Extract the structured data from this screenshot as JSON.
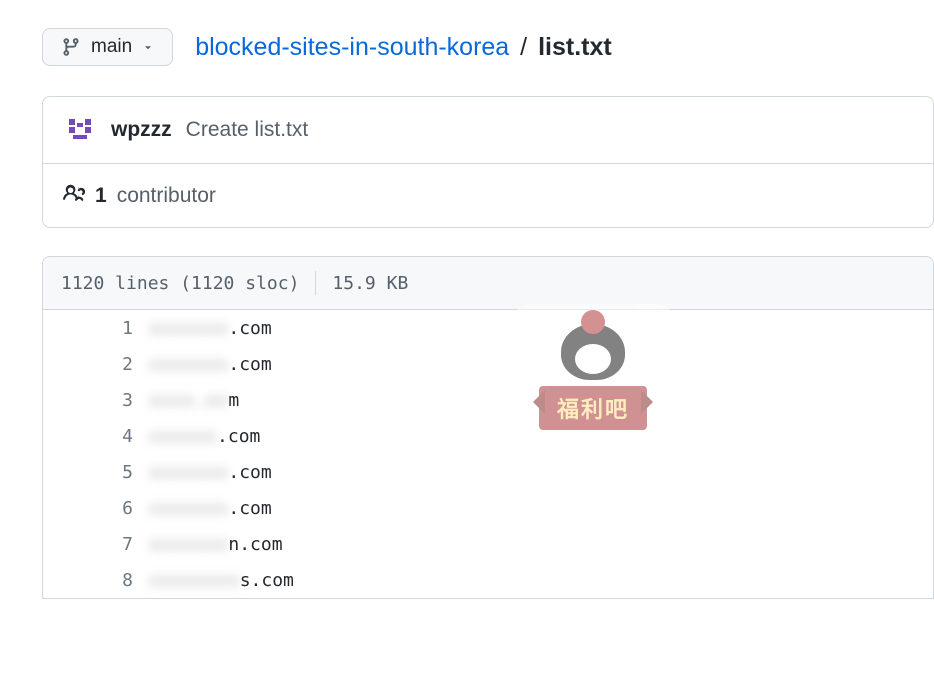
{
  "branch": {
    "name": "main"
  },
  "breadcrumb": {
    "repo": "blocked-sites-in-south-korea",
    "file": "list.txt"
  },
  "commit": {
    "author": "wpzzz",
    "message": "Create list.txt"
  },
  "contributors": {
    "count": "1",
    "label": "contributor"
  },
  "file_stats": {
    "lines": "1120 lines (1120 sloc)",
    "size": "15.9 KB"
  },
  "watermark": {
    "text": "福利吧"
  },
  "code": {
    "lines": [
      {
        "num": "1",
        "blurred": "xxxxxxx",
        "clear": ".com"
      },
      {
        "num": "2",
        "blurred": "xxxxxxx",
        "clear": ".com"
      },
      {
        "num": "3",
        "blurred": "xxxx.xx",
        "clear": "m"
      },
      {
        "num": "4",
        "blurred": "xxxxxx",
        "clear": ".com"
      },
      {
        "num": "5",
        "blurred": "xxxxxxx",
        "clear": ".com"
      },
      {
        "num": "6",
        "blurred": "xxxxxxx",
        "clear": ".com"
      },
      {
        "num": "7",
        "blurred": "xxxxxxx",
        "clear": "n.com"
      },
      {
        "num": "8",
        "blurred": "xxxxxxxx",
        "clear": "s.com"
      }
    ]
  }
}
